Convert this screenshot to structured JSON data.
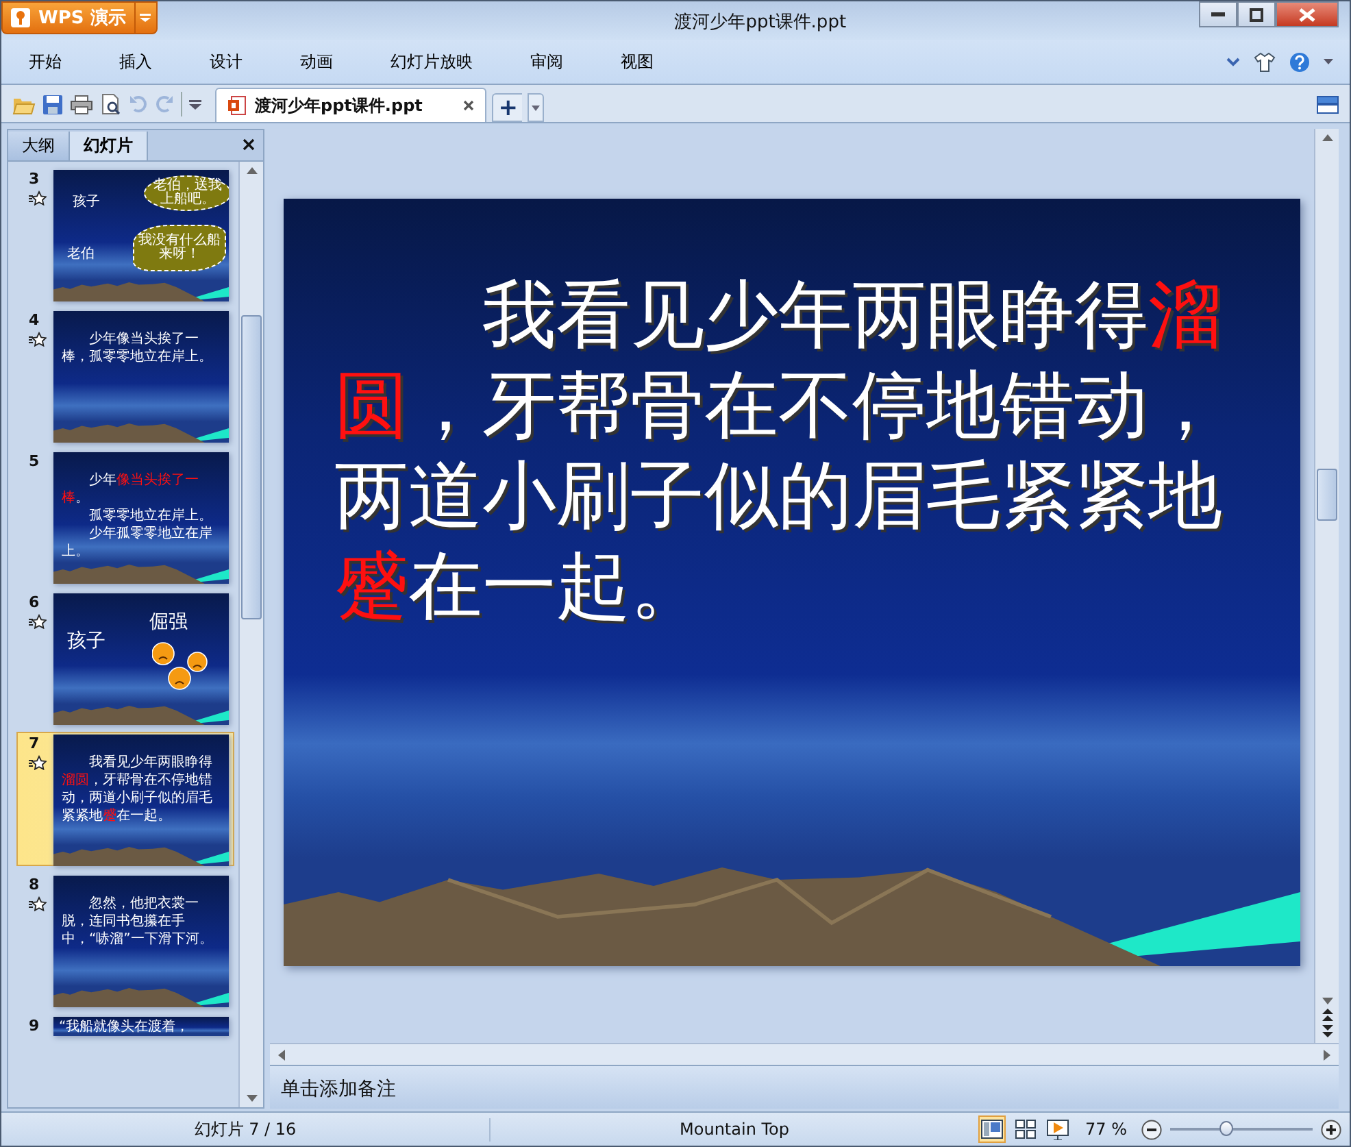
{
  "window": {
    "app_button": "WPS 演示",
    "title": "渡河少年ppt课件.ppt"
  },
  "menu": [
    {
      "label": "开始"
    },
    {
      "label": "插入"
    },
    {
      "label": "设计"
    },
    {
      "label": "动画"
    },
    {
      "label": "幻灯片放映"
    },
    {
      "label": "审阅"
    },
    {
      "label": "视图"
    }
  ],
  "toolbar": [
    {
      "kind": "open",
      "disabled": false
    },
    {
      "kind": "save",
      "disabled": false
    },
    {
      "kind": "print",
      "disabled": false
    },
    {
      "kind": "preview",
      "disabled": false
    },
    {
      "kind": "undo",
      "disabled": true
    },
    {
      "kind": "redo",
      "disabled": true
    }
  ],
  "document_tab": {
    "label": "渡河少年ppt课件.ppt",
    "selected": true,
    "new_tab": "+"
  },
  "side_tabs": [
    {
      "label": "大纲",
      "selected": false
    },
    {
      "label": "幻灯片",
      "selected": true
    }
  ],
  "thumbnails": [
    {
      "number": "3",
      "animated": true,
      "selected": false,
      "kind": "dialog",
      "labels": [
        "孩子",
        "老伯"
      ],
      "bubbles": [
        "老伯，送我上船吧。",
        "我没有什么船来呀！"
      ]
    },
    {
      "number": "4",
      "animated": true,
      "selected": false,
      "kind": "text",
      "lines": [
        [
          {
            "text": "少年像当头挨了一棒，孤零零地立在岸上。",
            "highlight": false
          }
        ]
      ]
    },
    {
      "number": "5",
      "animated": false,
      "selected": false,
      "kind": "text",
      "lines": [
        [
          {
            "text": "少年",
            "highlight": false
          },
          {
            "text": "像当头挨了一棒",
            "highlight": true
          },
          {
            "text": "。",
            "highlight": false
          }
        ],
        [
          {
            "text": "孤零零地立在岸上。",
            "highlight": false
          }
        ],
        [
          {
            "text": "少年孤零零地立在岸上。",
            "highlight": false
          }
        ]
      ]
    },
    {
      "number": "6",
      "animated": true,
      "selected": false,
      "kind": "faces",
      "labels": [
        "孩子",
        "倔强"
      ]
    },
    {
      "number": "7",
      "animated": true,
      "selected": true,
      "kind": "text",
      "lines": [
        [
          {
            "text": "我看见少年两眼睁得",
            "highlight": false
          },
          {
            "text": "溜圆",
            "highlight": true
          },
          {
            "text": "，牙帮骨在不停地错动，两道小刷子似的眉毛紧紧地",
            "highlight": false
          },
          {
            "text": "蹙",
            "highlight": true
          },
          {
            "text": "在一起。",
            "highlight": false
          }
        ]
      ]
    },
    {
      "number": "8",
      "animated": true,
      "selected": false,
      "kind": "text",
      "lines": [
        [
          {
            "text": "忽然，他把衣裳一脱，连同书包攥在手中，“哧溜”一下滑下河。",
            "highlight": false
          }
        ]
      ]
    },
    {
      "number": "9",
      "animated": false,
      "selected": false,
      "kind": "partial",
      "lines": [
        [
          {
            "text": "“我船就像头在渡着，",
            "highlight": false
          }
        ]
      ]
    }
  ],
  "slide": {
    "paragraph": [
      {
        "text": "我看见少年两眼睁得",
        "highlight": false
      },
      {
        "text": "溜圆",
        "highlight": true
      },
      {
        "text": "，牙帮骨在不停地错动，两道小刷子似的眉毛紧紧地",
        "highlight": false
      },
      {
        "text": "蹙",
        "highlight": true
      },
      {
        "text": "在一起。",
        "highlight": false
      }
    ]
  },
  "notes": {
    "placeholder": "单击添加备注"
  },
  "status_bar": {
    "slide_position": "幻灯片 7 / 16",
    "theme": "Mountain Top",
    "views": [
      {
        "kind": "normal",
        "selected": true
      },
      {
        "kind": "sorter",
        "selected": false
      },
      {
        "kind": "show",
        "selected": false
      }
    ],
    "zoom": "77 %",
    "zoom_slider": {
      "level": 0.4
    }
  }
}
